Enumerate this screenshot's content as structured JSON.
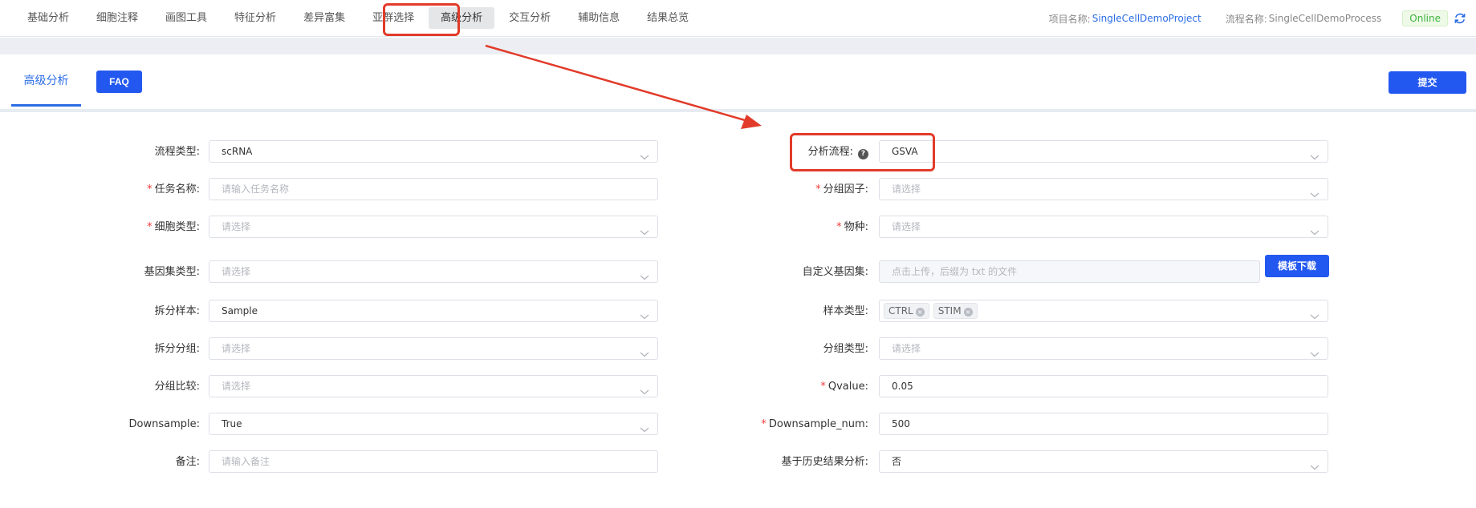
{
  "nav": {
    "items": [
      "基础分析",
      "细胞注释",
      "画图工具",
      "特征分析",
      "差异富集",
      "亚群选择",
      "高级分析",
      "交互分析",
      "辅助信息",
      "结果总览"
    ],
    "active_index": 6,
    "project_label": "项目名称:",
    "project_value": "SingleCellDemoProject",
    "process_label": "流程名称:",
    "process_value": "SingleCellDemoProcess",
    "status": "Online",
    "refresh_icon": "refresh-icon"
  },
  "panel": {
    "tab": "高级分析",
    "faq": "FAQ",
    "submit": "提交"
  },
  "form": {
    "left": [
      {
        "key": "flow_type",
        "label": "流程类型:",
        "required": false,
        "value": "scRNA",
        "placeholder": "",
        "kind": "select"
      },
      {
        "key": "task_name",
        "label": "任务名称:",
        "required": true,
        "value": "",
        "placeholder": "请输入任务名称",
        "kind": "input"
      },
      {
        "key": "cell_type",
        "label": "细胞类型:",
        "required": true,
        "value": "",
        "placeholder": "请选择",
        "kind": "select"
      },
      {
        "key": "geneset_type",
        "label": "基因集类型:",
        "required": false,
        "value": "",
        "placeholder": "请选择",
        "kind": "select"
      },
      {
        "key": "split_sample",
        "label": "拆分样本:",
        "required": false,
        "value": "Sample",
        "placeholder": "",
        "kind": "select"
      },
      {
        "key": "split_group",
        "label": "拆分分组:",
        "required": false,
        "value": "",
        "placeholder": "请选择",
        "kind": "select"
      },
      {
        "key": "group_compare",
        "label": "分组比较:",
        "required": false,
        "value": "",
        "placeholder": "请选择",
        "kind": "select"
      },
      {
        "key": "downsample",
        "label": "Downsample:",
        "required": false,
        "value": "True",
        "placeholder": "",
        "kind": "select"
      },
      {
        "key": "remark",
        "label": "备注:",
        "required": false,
        "value": "",
        "placeholder": "请输入备注",
        "kind": "input"
      }
    ],
    "right": [
      {
        "key": "analysis_flow",
        "label": "分析流程:",
        "required": false,
        "value": "GSVA",
        "placeholder": "",
        "kind": "select",
        "help": "?"
      },
      {
        "key": "group_factor",
        "label": "分组因子:",
        "required": true,
        "value": "",
        "placeholder": "请选择",
        "kind": "select"
      },
      {
        "key": "species",
        "label": "物种:",
        "required": true,
        "value": "",
        "placeholder": "请选择",
        "kind": "select"
      },
      {
        "key": "custom_geneset",
        "label": "自定义基因集:",
        "required": false,
        "value": "",
        "placeholder": "点击上传，后缀为 txt 的文件",
        "kind": "upload",
        "button": "模板下载"
      },
      {
        "key": "sample_type",
        "label": "样本类型:",
        "required": false,
        "value": "",
        "placeholder": "",
        "kind": "tags",
        "tags": [
          "CTRL",
          "STIM"
        ]
      },
      {
        "key": "group_type",
        "label": "分组类型:",
        "required": false,
        "value": "",
        "placeholder": "请选择",
        "kind": "select"
      },
      {
        "key": "qvalue",
        "label": "Qvalue:",
        "required": true,
        "value": "0.05",
        "placeholder": "",
        "kind": "input"
      },
      {
        "key": "downsample_num",
        "label": "Downsample_num:",
        "required": true,
        "value": "500",
        "placeholder": "",
        "kind": "input"
      },
      {
        "key": "history",
        "label": "基于历史结果分析:",
        "required": false,
        "value": "否",
        "placeholder": "",
        "kind": "select"
      }
    ]
  },
  "colors": {
    "primary": "#2358f0",
    "link": "#2b6de5",
    "annotation": "#e23b2a",
    "online": "#3db33d"
  }
}
